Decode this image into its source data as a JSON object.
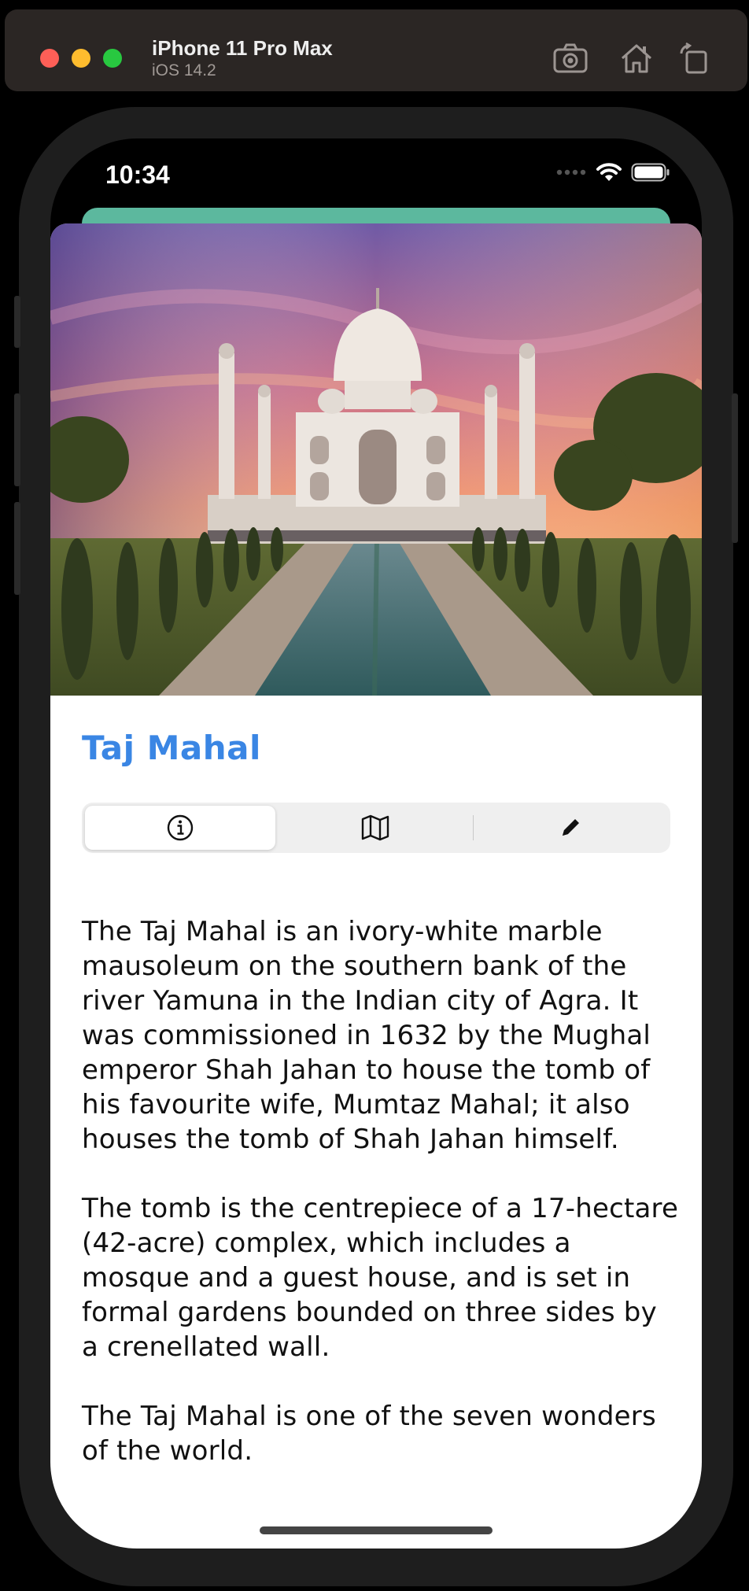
{
  "simulator": {
    "device_name": "iPhone 11 Pro Max",
    "os_version": "iOS 14.2",
    "toolbar_icons": [
      "screenshot-icon",
      "home-icon",
      "rotate-icon"
    ]
  },
  "status_bar": {
    "time": "10:34",
    "icons": [
      "signal-dots-icon",
      "wifi-icon",
      "battery-icon"
    ]
  },
  "landmark": {
    "title": "Taj Mahal",
    "title_color": "#3a86e4",
    "photo": "taj-mahal-photo"
  },
  "tabs": [
    {
      "icon": "info-icon",
      "selected": true
    },
    {
      "icon": "map-icon",
      "selected": false
    },
    {
      "icon": "pencil-icon",
      "selected": false
    }
  ],
  "description": [
    "The Taj Mahal is an ivory-white marble mausoleum on the southern bank of the river Yamuna in the Indian city of Agra. It was commissioned in 1632 by the Mughal emperor Shah Jahan to house the tomb of his favourite wife, Mumtaz Mahal; it also houses the tomb of Shah Jahan himself.",
    "The tomb is the centrepiece of a 17-hectare (42-acre) complex, which includes a mosque and a guest house, and is set in formal gardens bounded on three sides by a crenellated wall.",
    "The Taj Mahal is one of the seven wonders of the world."
  ],
  "colors": {
    "accent": "#3a86e4",
    "sheet_behind": "#5cb89e"
  }
}
